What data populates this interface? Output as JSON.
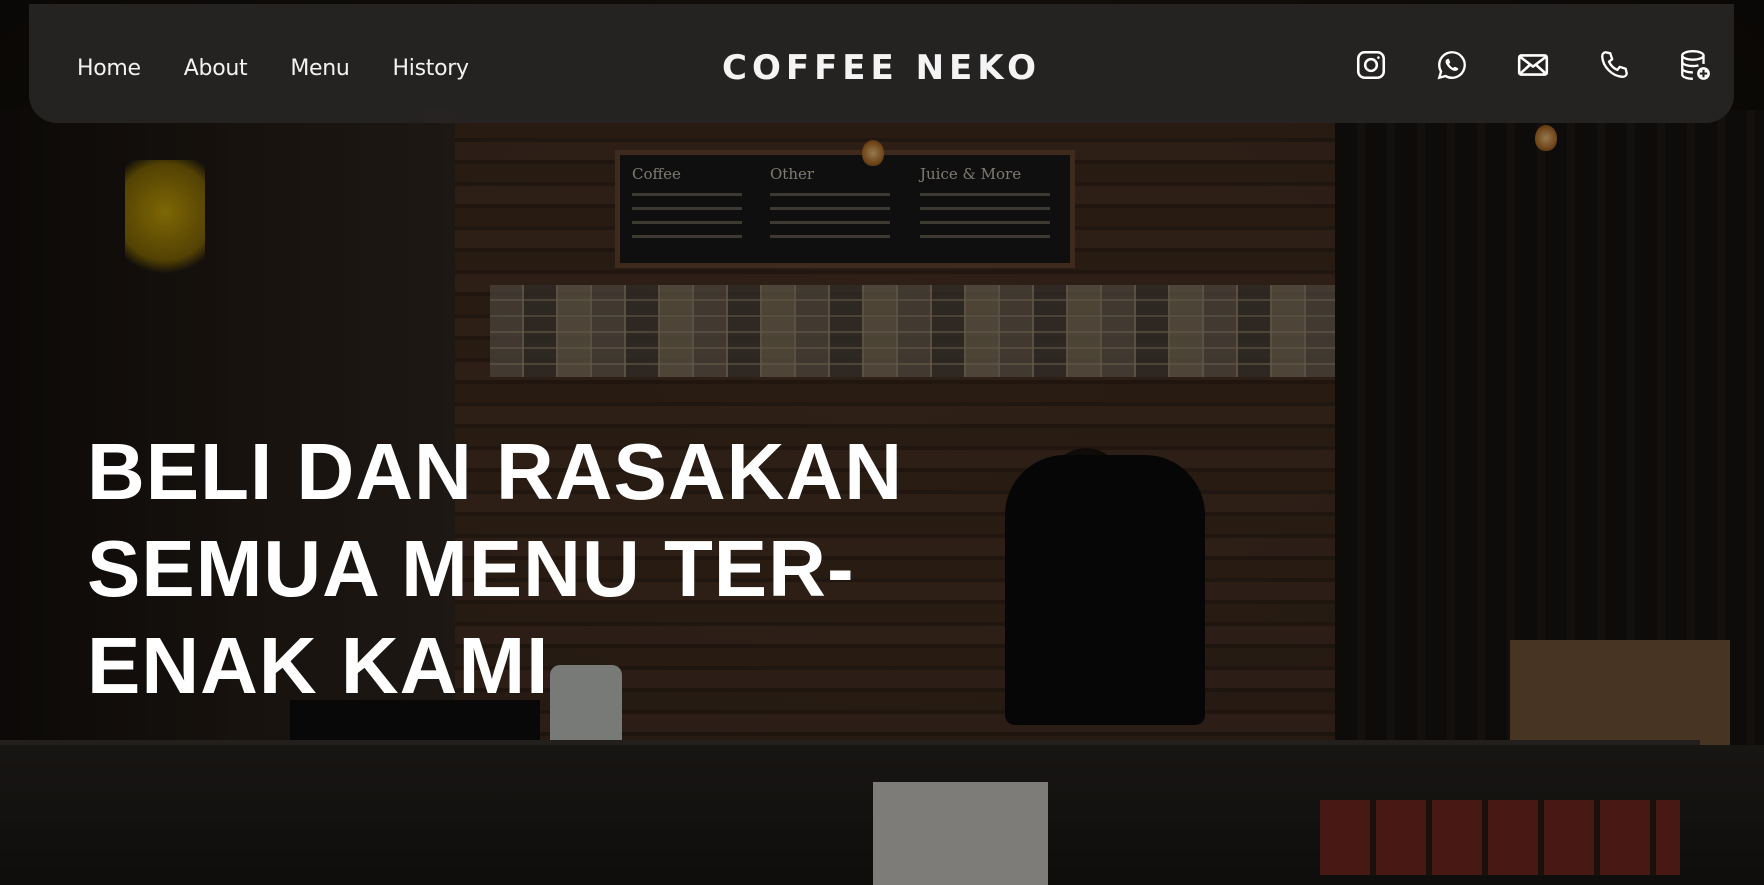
{
  "navbar": {
    "links": [
      "Home",
      "About",
      "Menu",
      "History"
    ],
    "brand": "COFFEE NEKO",
    "icons": [
      "instagram-icon",
      "whatsapp-icon",
      "mail-icon",
      "phone-icon",
      "database-add-icon"
    ]
  },
  "hero": {
    "headline_lines": [
      "BELI DAN RASAKAN",
      "SEMUA MENU TER-",
      "ENAK KAMI"
    ]
  },
  "scene": {
    "menu_board": {
      "columns": [
        "Coffee",
        "Other",
        "Juice & More"
      ]
    }
  },
  "colors": {
    "navbar_bg": "#262423",
    "text": "#ffffff",
    "overlay": "#000000"
  }
}
